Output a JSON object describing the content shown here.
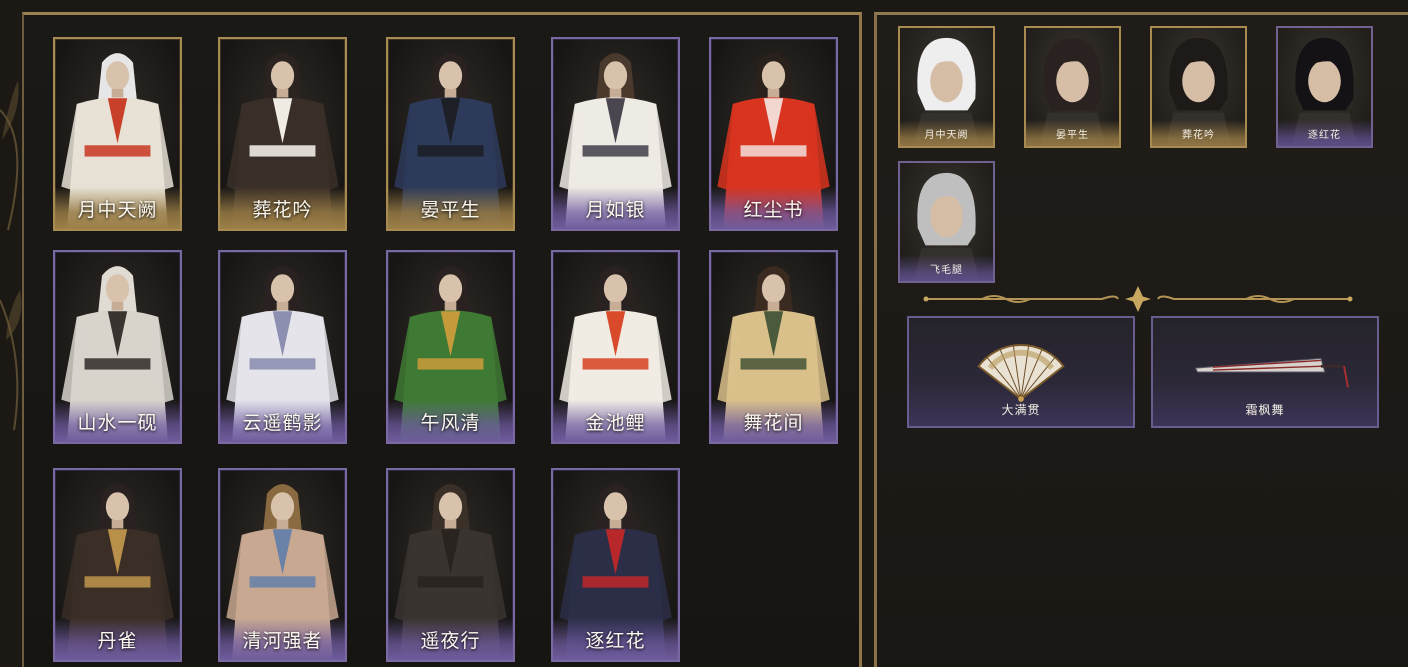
{
  "outfits": [
    {
      "name": "月中天阙",
      "rarity": "gold",
      "palette": {
        "robe": "#e8e2d6",
        "accent": "#c9402a",
        "hair": "#e6e6e6"
      }
    },
    {
      "name": "葬花吟",
      "rarity": "gold",
      "palette": {
        "robe": "#3a2f28",
        "accent": "#f0ece4",
        "hair": "#2a2320"
      }
    },
    {
      "name": "晏平生",
      "rarity": "gold",
      "palette": {
        "robe": "#2d3a5a",
        "accent": "#1c1f26",
        "hair": "#2a2220"
      }
    },
    {
      "name": "月如银",
      "rarity": "purple",
      "palette": {
        "robe": "#eeeae4",
        "accent": "#4a4650",
        "hair": "#4a3a2e"
      }
    },
    {
      "name": "红尘书",
      "rarity": "purple",
      "palette": {
        "robe": "#d8341f",
        "accent": "#f2d6d0",
        "hair": "#2a201c"
      }
    },
    {
      "name": "山水一砚",
      "rarity": "purple",
      "palette": {
        "robe": "#d8d4cc",
        "accent": "#3a3430",
        "hair": "#e0dcd4"
      }
    },
    {
      "name": "云遥鹤影",
      "rarity": "purple",
      "palette": {
        "robe": "#e4e4ea",
        "accent": "#8c8fb0",
        "hair": "#2a2220"
      }
    },
    {
      "name": "午风清",
      "rarity": "purple",
      "palette": {
        "robe": "#3f7a35",
        "accent": "#c49a3a",
        "hair": "#2a2220"
      }
    },
    {
      "name": "金池鲤",
      "rarity": "purple",
      "palette": {
        "robe": "#f0ece4",
        "accent": "#d84a2a",
        "hair": "#2a2220"
      }
    },
    {
      "name": "舞花间",
      "rarity": "purple",
      "palette": {
        "robe": "#d9c08a",
        "accent": "#4b5a3a",
        "hair": "#3a2a20"
      }
    },
    {
      "name": "丹雀",
      "rarity": "purple",
      "palette": {
        "robe": "#3a2e26",
        "accent": "#b8904a",
        "hair": "#2a2220"
      }
    },
    {
      "name": "清河强者",
      "rarity": "purple",
      "palette": {
        "robe": "#c8a890",
        "accent": "#6a82a8",
        "hair": "#8a6a40"
      }
    },
    {
      "name": "遥夜行",
      "rarity": "purple",
      "palette": {
        "robe": "#3a3430",
        "accent": "#2a2420",
        "hair": "#3a3028"
      }
    },
    {
      "name": "逐红花",
      "rarity": "purple",
      "palette": {
        "robe": "#2c2e48",
        "accent": "#b8282a",
        "hair": "#2a2220"
      }
    }
  ],
  "hairstyles": [
    {
      "name": "月中天阙",
      "rarity": "gold",
      "hair": "#eeeeee"
    },
    {
      "name": "晏平生",
      "rarity": "gold",
      "hair": "#2a2220"
    },
    {
      "name": "葬花吟",
      "rarity": "gold",
      "hair": "#1e1a18"
    },
    {
      "name": "逐红花",
      "rarity": "purple",
      "hair": "#141214"
    },
    {
      "name": "飞毛腿",
      "rarity": "purple",
      "hair": "#bfbfbf"
    }
  ],
  "weapons": [
    {
      "name": "大满贯",
      "kind": "fan"
    },
    {
      "name": "霜枫舞",
      "kind": "umbrella"
    }
  ]
}
